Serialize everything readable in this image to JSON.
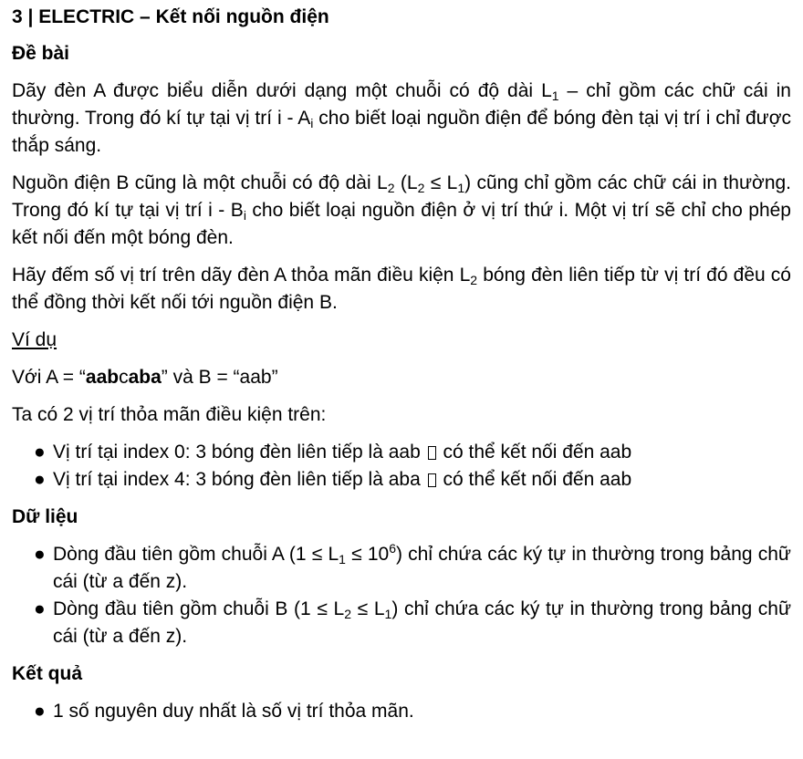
{
  "title": "3 | ELECTRIC – Kết nối nguồn điện",
  "de_bai": {
    "heading": "Đề bài",
    "p1": {
      "a": "Dãy đèn A được biểu diễn dưới dạng một chuỗi có độ dài L",
      "a_sub": "1",
      "b": " – chỉ gồm các chữ cái in thường. Trong đó kí tự tại vị trí i - A",
      "b_sub": "i",
      "c": " cho biết loại nguồn điện để bóng đèn tại vị trí i chỉ được thắp sáng."
    },
    "p2": {
      "a": "Nguồn điện B cũng là một chuỗi có độ dài L",
      "a_sub": "2",
      "b": " (L",
      "b_sub": "2",
      "c": " ≤ L",
      "c_sub": "1",
      "d": ") cũng chỉ gồm các chữ cái in thường. Trong đó kí tự tại vị trí i - B",
      "d_sub": "i",
      "e": " cho biết loại nguồn điện ở vị trí thứ i. Một vị trí sẽ chỉ cho phép kết nối đến một bóng đèn."
    },
    "p3": {
      "a": "Hãy đếm số vị trí trên dãy đèn A thỏa mãn điều kiện L",
      "a_sub": "2",
      "b": " bóng đèn liên tiếp từ vị trí đó đều có thể đồng thời kết nối tới nguồn điện B."
    }
  },
  "vi_du": {
    "heading": "Ví dụ",
    "line1": {
      "a": "Với A = “",
      "bold1": "aab",
      "normal": "c",
      "bold2": "aba",
      "b": "” và B = “aab”"
    },
    "line2": "Ta có 2 vị trí thỏa mãn điều kiện trên:",
    "items": [
      {
        "a": "Vị trí tại index 0: 3 bóng đèn liên tiếp là aab",
        "b": "có thể kết nối đến aab"
      },
      {
        "a": "Vị trí tại index 4: 3 bóng đèn liên tiếp là aba",
        "b": "có thể kết nối đến aab"
      }
    ]
  },
  "du_lieu": {
    "heading": "Dữ liệu",
    "item1": {
      "a": "Dòng đầu tiên gồm chuỗi A (1 ≤ L",
      "a_sub": "1",
      "b": " ≤ 10",
      "b_sup": "6",
      "c": ") chỉ chứa các ký tự in thường trong bảng chữ cái (từ a đến z)."
    },
    "item2": {
      "a": "Dòng đầu tiên gồm chuỗi B (1 ≤ L",
      "a_sub": "2",
      "b": " ≤ L",
      "b_sub": "1",
      "c": ") chỉ chứa các ký tự in thường trong bảng chữ cái (từ a đến z)."
    }
  },
  "ket_qua": {
    "heading": "Kết quả",
    "item1": "1 số nguyên duy nhất là số vị trí thỏa mãn."
  },
  "bullet_char": "●"
}
